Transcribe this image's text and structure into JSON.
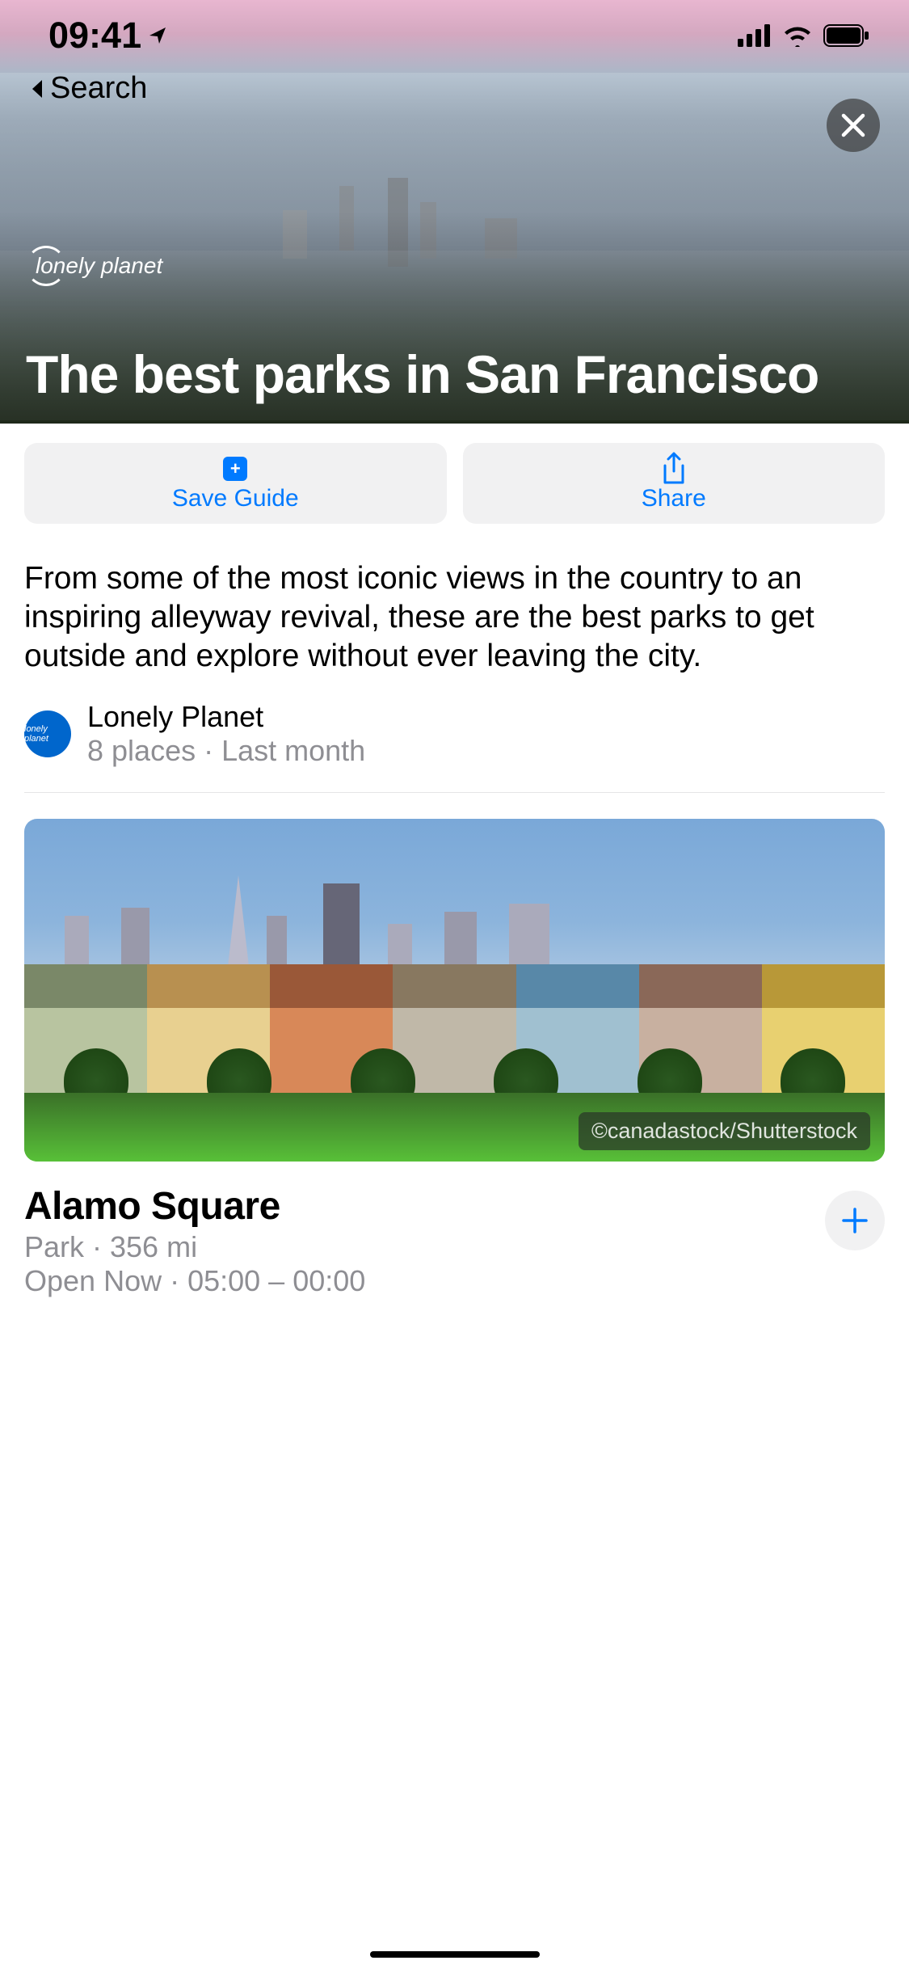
{
  "status": {
    "time": "09:41"
  },
  "nav": {
    "back_label": "Search"
  },
  "hero": {
    "logo_text": "lonely planet",
    "title": "The best parks in San Francisco"
  },
  "actions": {
    "save": "Save Guide",
    "share": "Share"
  },
  "description": "From some of the most iconic views in the country to an inspiring alleyway revival, these are the best parks to get outside and explore without ever leaving the city.",
  "author": {
    "name": "Lonely Planet",
    "meta": "8 places · Last month",
    "avatar_label": "lonely planet"
  },
  "place": {
    "attribution": "©canadastock/Shutterstock",
    "title": "Alamo Square",
    "meta": "Park · 356 mi",
    "hours": "Open Now · 05:00 – 00:00"
  }
}
